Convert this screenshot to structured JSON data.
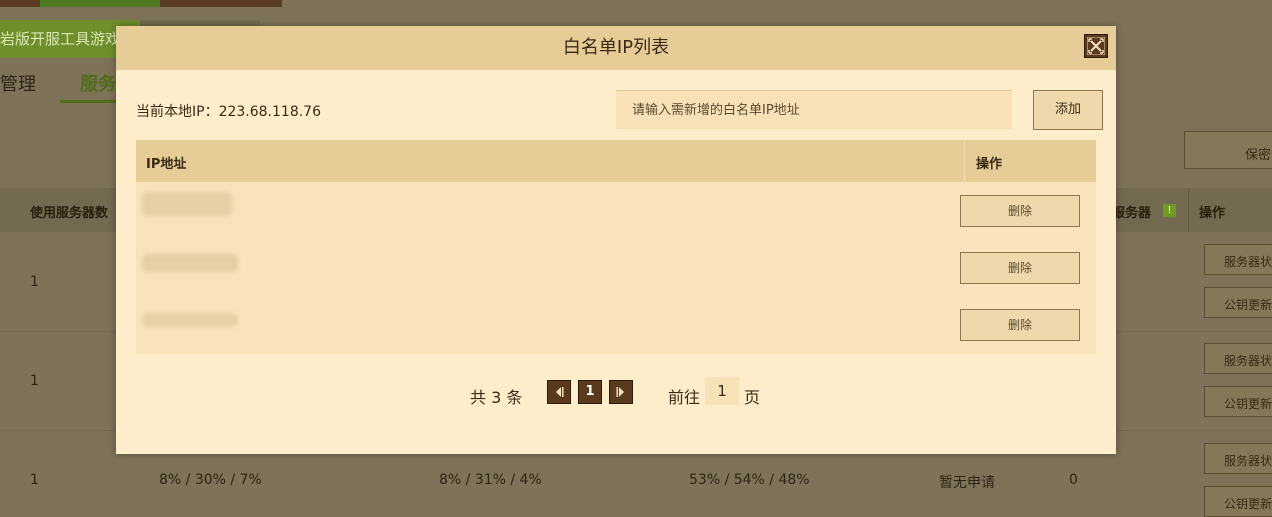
{
  "background": {
    "banner_text": "岩版开服工具游戏",
    "tabs": [
      "管理",
      "服务"
    ],
    "save_button": "保密",
    "table_headers": {
      "servers_used": "使用服务器数",
      "server": "服务器",
      "actions": "操作"
    },
    "rows": [
      {
        "servers_used": "1"
      },
      {
        "servers_used": "1"
      },
      {
        "servers_used": "1",
        "col2": "8% / 30% / 7%",
        "col3": "8% / 31% / 4%",
        "col4": "53% / 54% / 48%",
        "status": "暂无申请",
        "count": "0"
      }
    ],
    "row_buttons": {
      "status": "服务器状",
      "key_update": "公钥更新"
    }
  },
  "modal": {
    "title": "白名单IP列表",
    "local_ip_label": "当前本地IP：223.68.118.76",
    "ip_input_placeholder": "请输入需新增的白名单IP地址",
    "add_button": "添加",
    "table": {
      "col_ip": "IP地址",
      "col_action": "操作",
      "rows": [
        {
          "ip": "•••.•••.•••.•••",
          "action": "删除"
        },
        {
          "ip": "•••.•••.•••.•••",
          "action": "删除"
        },
        {
          "ip": "•••.•••.•••.•••",
          "action": "删除"
        }
      ]
    },
    "pagination": {
      "total_text": "共 3 条",
      "current_page": "1",
      "goto_label": "前往",
      "goto_value": "1",
      "page_unit": "页"
    }
  },
  "colors": {
    "overlay_bg": "#7e7358",
    "modal_bg": "#fdedcb",
    "header_bg": "#e6cd98",
    "dark_button": "#5a3a1c"
  },
  "icons": [
    "close-icon",
    "chevron-left-icon",
    "chevron-right-icon",
    "exclamation-icon"
  ]
}
